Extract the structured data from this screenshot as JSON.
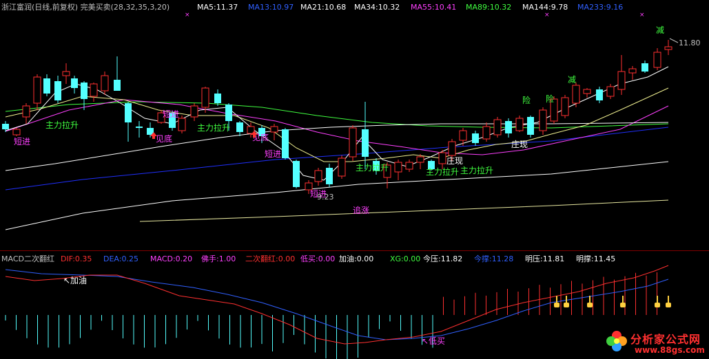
{
  "main_header": {
    "stock_title": "浙江富润(日线,前复权) 完美买卖(28,32,35,3,20)",
    "ma_items": [
      {
        "label": "MA5:11.37",
        "color": "#ffffff"
      },
      {
        "label": "MA13:10.97",
        "color": "#3060ff"
      },
      {
        "label": "MA21:10.68",
        "color": "#ffffff"
      },
      {
        "label": "MA34:10.32",
        "color": "#ffffff"
      },
      {
        "label": "MA55:10.41",
        "color": "#ff40ff"
      },
      {
        "label": "MA89:10.32",
        "color": "#40ff40"
      },
      {
        "label": "MA144:9.78",
        "color": "#ffffff"
      },
      {
        "label": "MA233:9.16",
        "color": "#3060ff"
      }
    ],
    "price_high_label": "11.80",
    "price_low_label": "9.23"
  },
  "main_annotations": [
    {
      "text": "主力拉升",
      "color": "#40ff40"
    },
    {
      "text": "短进",
      "color": "#ff40ff"
    },
    {
      "text": "见底",
      "color": "#ff40ff"
    },
    {
      "text": "短进",
      "color": "#ff40ff"
    },
    {
      "text": "主力拉升",
      "color": "#40ff40"
    },
    {
      "text": "见底",
      "color": "#ff40ff"
    },
    {
      "text": "短进",
      "color": "#ff40ff"
    },
    {
      "text": "主力拉升",
      "color": "#40ff40"
    },
    {
      "text": "短进",
      "color": "#ff40ff"
    },
    {
      "text": "追涨",
      "color": "#ff40ff"
    },
    {
      "text": "主力拉升",
      "color": "#40ff40"
    },
    {
      "text": "主力拉升",
      "color": "#40ff40"
    },
    {
      "text": "庄现",
      "color": "#ffffff"
    },
    {
      "text": "庄现",
      "color": "#ffffff"
    },
    {
      "text": "险",
      "color": "#40ff40"
    },
    {
      "text": "险",
      "color": "#40ff40"
    },
    {
      "text": "减",
      "color": "#40ff40"
    },
    {
      "text": "减",
      "color": "#40ff40"
    }
  ],
  "sub_header": {
    "items": [
      {
        "label": "MACD二次翻红",
        "color": "#c0c0c0"
      },
      {
        "label": "DIF:0.35",
        "color": "#ff3030"
      },
      {
        "label": "DEA:0.25",
        "color": "#3060ff"
      },
      {
        "label": "MACD:0.20",
        "color": "#ff40ff"
      },
      {
        "label": "佛手:1.00",
        "color": "#ff40ff"
      },
      {
        "label": "二次翻红:0.00",
        "color": "#ff3030"
      },
      {
        "label": "低买:0.00",
        "color": "#ff40ff"
      },
      {
        "label": "加油:0.00",
        "color": "#ffffff"
      },
      {
        "label": "XG:0.00",
        "color": "#40ff40"
      },
      {
        "label": "今压:11.82",
        "color": "#ffffff"
      },
      {
        "label": "今撑:11.28",
        "color": "#3060ff"
      },
      {
        "label": "明压:11.81",
        "color": "#ffffff"
      },
      {
        "label": "明撑:11.45",
        "color": "#ffffff"
      }
    ]
  },
  "sub_annotations": [
    {
      "text": "加油",
      "color": "#ffffff"
    },
    {
      "text": "低买",
      "color": "#ff40ff"
    }
  ],
  "watermark": {
    "title": "分析家公式网",
    "url": "www.88gs.com"
  },
  "colors": {
    "up": "#ff3030",
    "down": "#54ffff",
    "bg": "#000000",
    "divider": "#800000"
  }
}
